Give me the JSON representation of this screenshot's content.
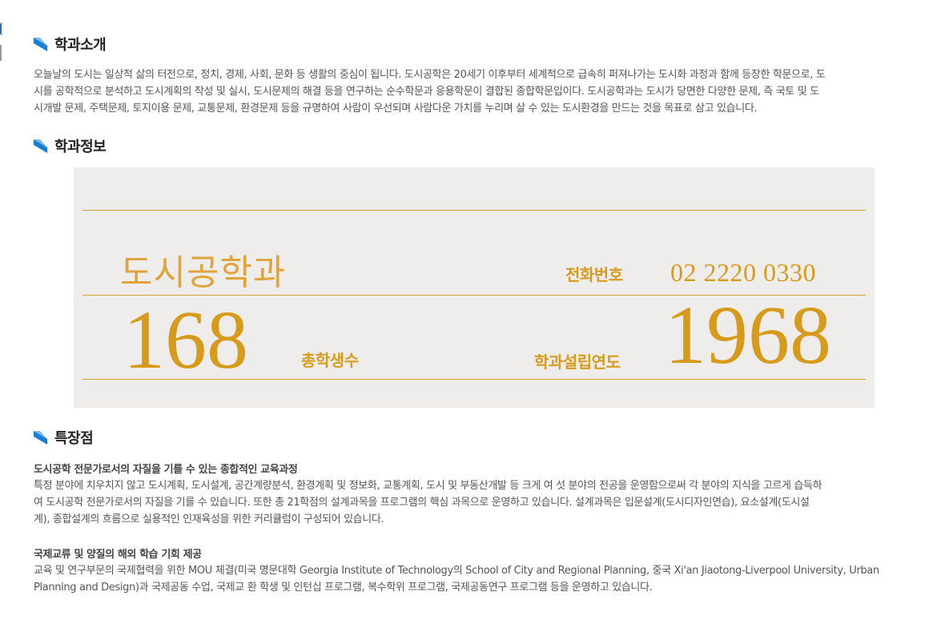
{
  "sections": {
    "intro": {
      "title": "학과소개"
    },
    "info": {
      "title": "학과정보"
    },
    "features": {
      "title": "특장점"
    }
  },
  "intro": {
    "lines": [
      "오늘날의 도시는 일상적 삶의 터전으로, 정치, 경제, 사회, 문화 등 생활의 중심이 됩니다. 도시공학은 20세기 이후부터 세계적으로 급속히 퍼져나가는 도시화 과정과 함께 등장한 학문으로, 도",
      "시를 공학적으로 분석하고 도시계획의 작성 및 실시, 도시문제의 해결 등을 연구하는 순수학문과 응용학문이 결합된 종합학문입이다. 도시공학과는 도시가 당면한 다양한 문제, 즉 국토 및 도",
      "시개발 문제, 주택문제, 토지이용 문제, 교통문제, 환경문제 등을 규명하여 사람이 우선되며 사람다운 가치를 누리며 살 수 있는 도시환경을 만드는 것을 목표로 삼고 있습니다."
    ]
  },
  "info": {
    "dept_name": "도시공학과",
    "phone_label": "전화번호",
    "phone": "02 2220 0330",
    "students_value": "168",
    "students_label": "총학생수",
    "founded_label": "학과설립연도",
    "founded_value": "1968"
  },
  "features": {
    "f1": {
      "title": "도시공학 전문가로서의 자질을 기를 수 있는 종합적인 교육과정",
      "lines": [
        "특정 분야에 치우치지 않고 도시계획, 도시설계, 공간계량분석, 환경계획 및 정보화, 교통계획, 도시 및 부동산개발 등 크게 여 섯 분야의 전공을 운영함으로써 각 분야의 지식을 고르게 습득하",
        "여 도시공학 전문가로서의 자질을 기를 수 있습니다. 또한 총 21학점의 설계과목을 프로그램의 핵심 과목으로 운영하고 있습니다. 설계과목은 입문설계(도시디자인연습), 요소설계(도시설",
        "계), 종합설계의 흐름으로 실용적인 인재육성을 위한 커리큘럼이 구성되어 있습니다."
      ]
    },
    "f2": {
      "title": "국제교류 및 양질의 해외 학습 기회 제공",
      "lines": [
        "교육 및 연구부문의 국제협력을 위한 MOU 체결(미국 명문대학 Georgia Institute of Technology의 School of City and Regional Planning, 중국 Xi'an Jiaotong-Liverpool University, Urban",
        "Planning and Design)과 국제공동 수업, 국제교 환 학생 및 인턴십 프로그램, 복수학위 프로그램, 국제공동연구 프로그램 등을 운영하고 있습니다."
      ]
    }
  },
  "colors": {
    "accent_blue": "#1a7fd0",
    "gold": "#d79b1c",
    "box_bg": "#eeedeb"
  }
}
